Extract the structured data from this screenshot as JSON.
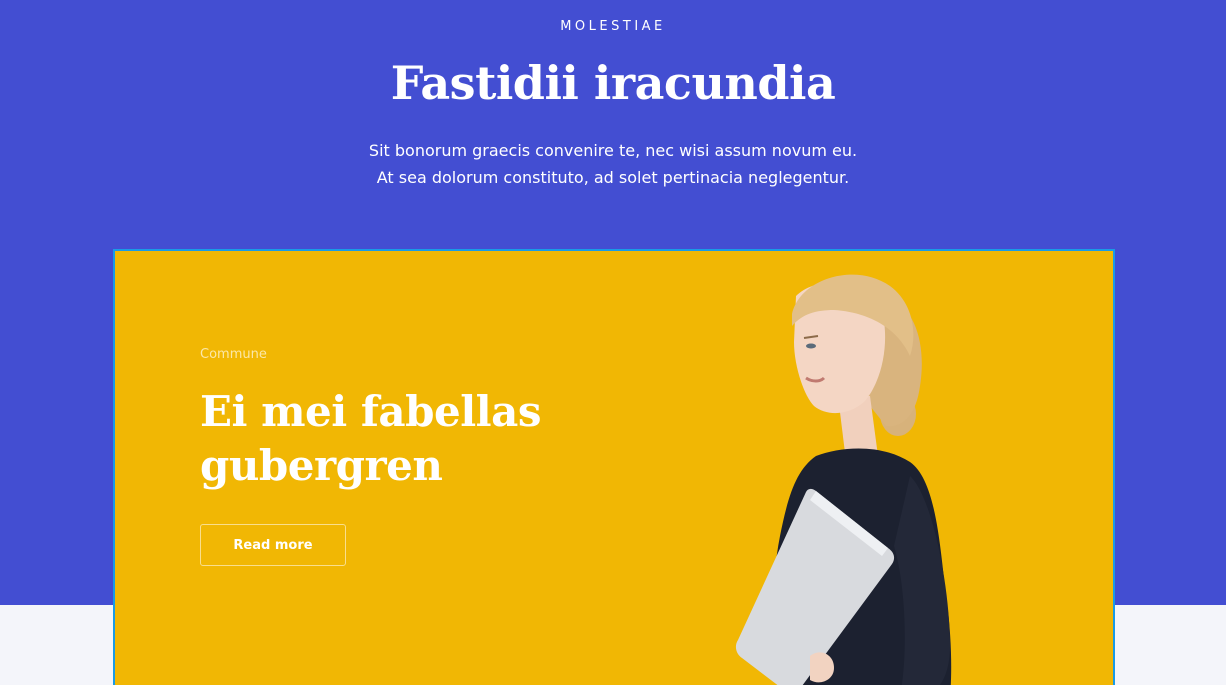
{
  "hero": {
    "eyebrow": "MOLESTIAE",
    "title": "Fastidii iracundia",
    "subtitle_lines": [
      "Sit bonorum graecis convenire te, nec wisi assum novum eu.",
      "At sea dolorum constituto, ad solet pertinacia neglegentur."
    ]
  },
  "card": {
    "kicker": "Commune",
    "title": "Ei mei fabellas gubergren",
    "button_label": "Read more",
    "image_icon": "woman-with-laptop-photo"
  },
  "colors": {
    "hero_background": "#434ed2",
    "card_background": "#f1b704",
    "card_border": "#1a9be6",
    "page_background": "#f4f5fa"
  }
}
